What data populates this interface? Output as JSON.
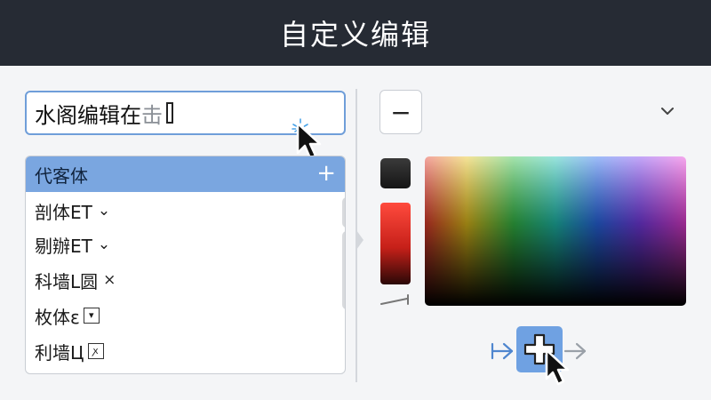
{
  "window": {
    "title": "自定义编辑"
  },
  "text_input": {
    "value": "水阁编辑在",
    "faded_suffix": "击"
  },
  "font_list": {
    "header": "代客体",
    "add_symbol": "+",
    "items": [
      {
        "label": "剖体ET",
        "glyph": "⌄"
      },
      {
        "label": "剔辦ET",
        "glyph": "⌄"
      },
      {
        "label": "科墙L圆",
        "glyph": "×"
      },
      {
        "label": "枚体ε",
        "glyph": "▾"
      },
      {
        "label": "利墙Ц",
        "glyph": "ꭗ"
      }
    ]
  },
  "color_panel": {
    "minus_label": "−",
    "swatch_color": "#222222",
    "picker_hues": [
      "#e63b2e",
      "#e8c21c",
      "#37c24a",
      "#20c4b4",
      "#2a6cf0",
      "#7a3ef0",
      "#ea3fd8"
    ],
    "accent_color": "#6fa1e2"
  },
  "icons": {
    "cursor": "pointer-cursor-icon",
    "chevron": "chevron-down-icon",
    "plus": "plus-icon",
    "arrow_left": "arrow-right-icon",
    "arrow_right": "arrow-right-icon"
  }
}
